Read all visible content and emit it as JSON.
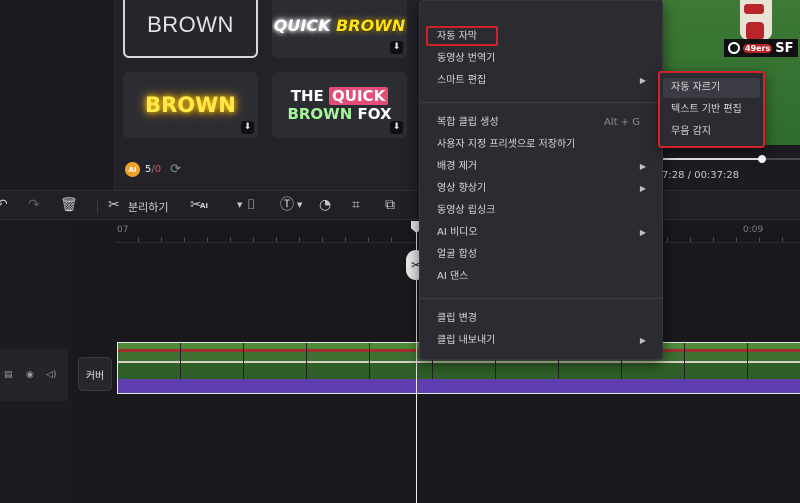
{
  "templates": {
    "card1": "BROWN",
    "card2_a": "QUICK",
    "card2_b": "BROWN",
    "card3": "BROWN",
    "card4_the": "THE",
    "card4_quick": "QUICK",
    "card4_brown": "BROWN",
    "card4_fox": "FOX"
  },
  "credits": {
    "badge": "AI",
    "used": "5",
    "sep": "/",
    "total": "0"
  },
  "preview": {
    "team": "SF",
    "team_logo": "49ers",
    "timecode_current": "7:28",
    "timecode_sep": " / ",
    "timecode_total": "00:37:28"
  },
  "toolbar": {
    "split_label": "분리하기",
    "ai_label": "AI"
  },
  "timeline": {
    "ruler_labels": [
      "07",
      "0:09"
    ],
    "cover_label": "커버"
  },
  "context_menu": {
    "items": [
      {
        "label": "자동 자막"
      },
      {
        "label": "동영상 번역기"
      },
      {
        "label": "스마트 편집",
        "has_submenu": true
      },
      {
        "label": "복합 클립 생성",
        "shortcut": "Alt + G"
      },
      {
        "label": "사용자 지정 프리셋으로 저장하기"
      },
      {
        "label": "배경 제거",
        "has_submenu": true
      },
      {
        "label": "영상 향상기",
        "has_submenu": true
      },
      {
        "label": "동영상 립싱크"
      },
      {
        "label": "AI 비디오",
        "has_submenu": true
      },
      {
        "label": "얼굴 합성"
      },
      {
        "label": "AI 댄스"
      },
      {
        "label": "클립 변경"
      },
      {
        "label": "클립 내보내기",
        "has_submenu": true
      }
    ]
  },
  "submenu": {
    "items": [
      "자동 자르기",
      "텍스트 기반 편집",
      "무음 감지"
    ]
  },
  "colors": {
    "highlight_box": "#d2232a",
    "audio_track": "#5f3fb0",
    "credit_coin": "#f0a32a"
  }
}
